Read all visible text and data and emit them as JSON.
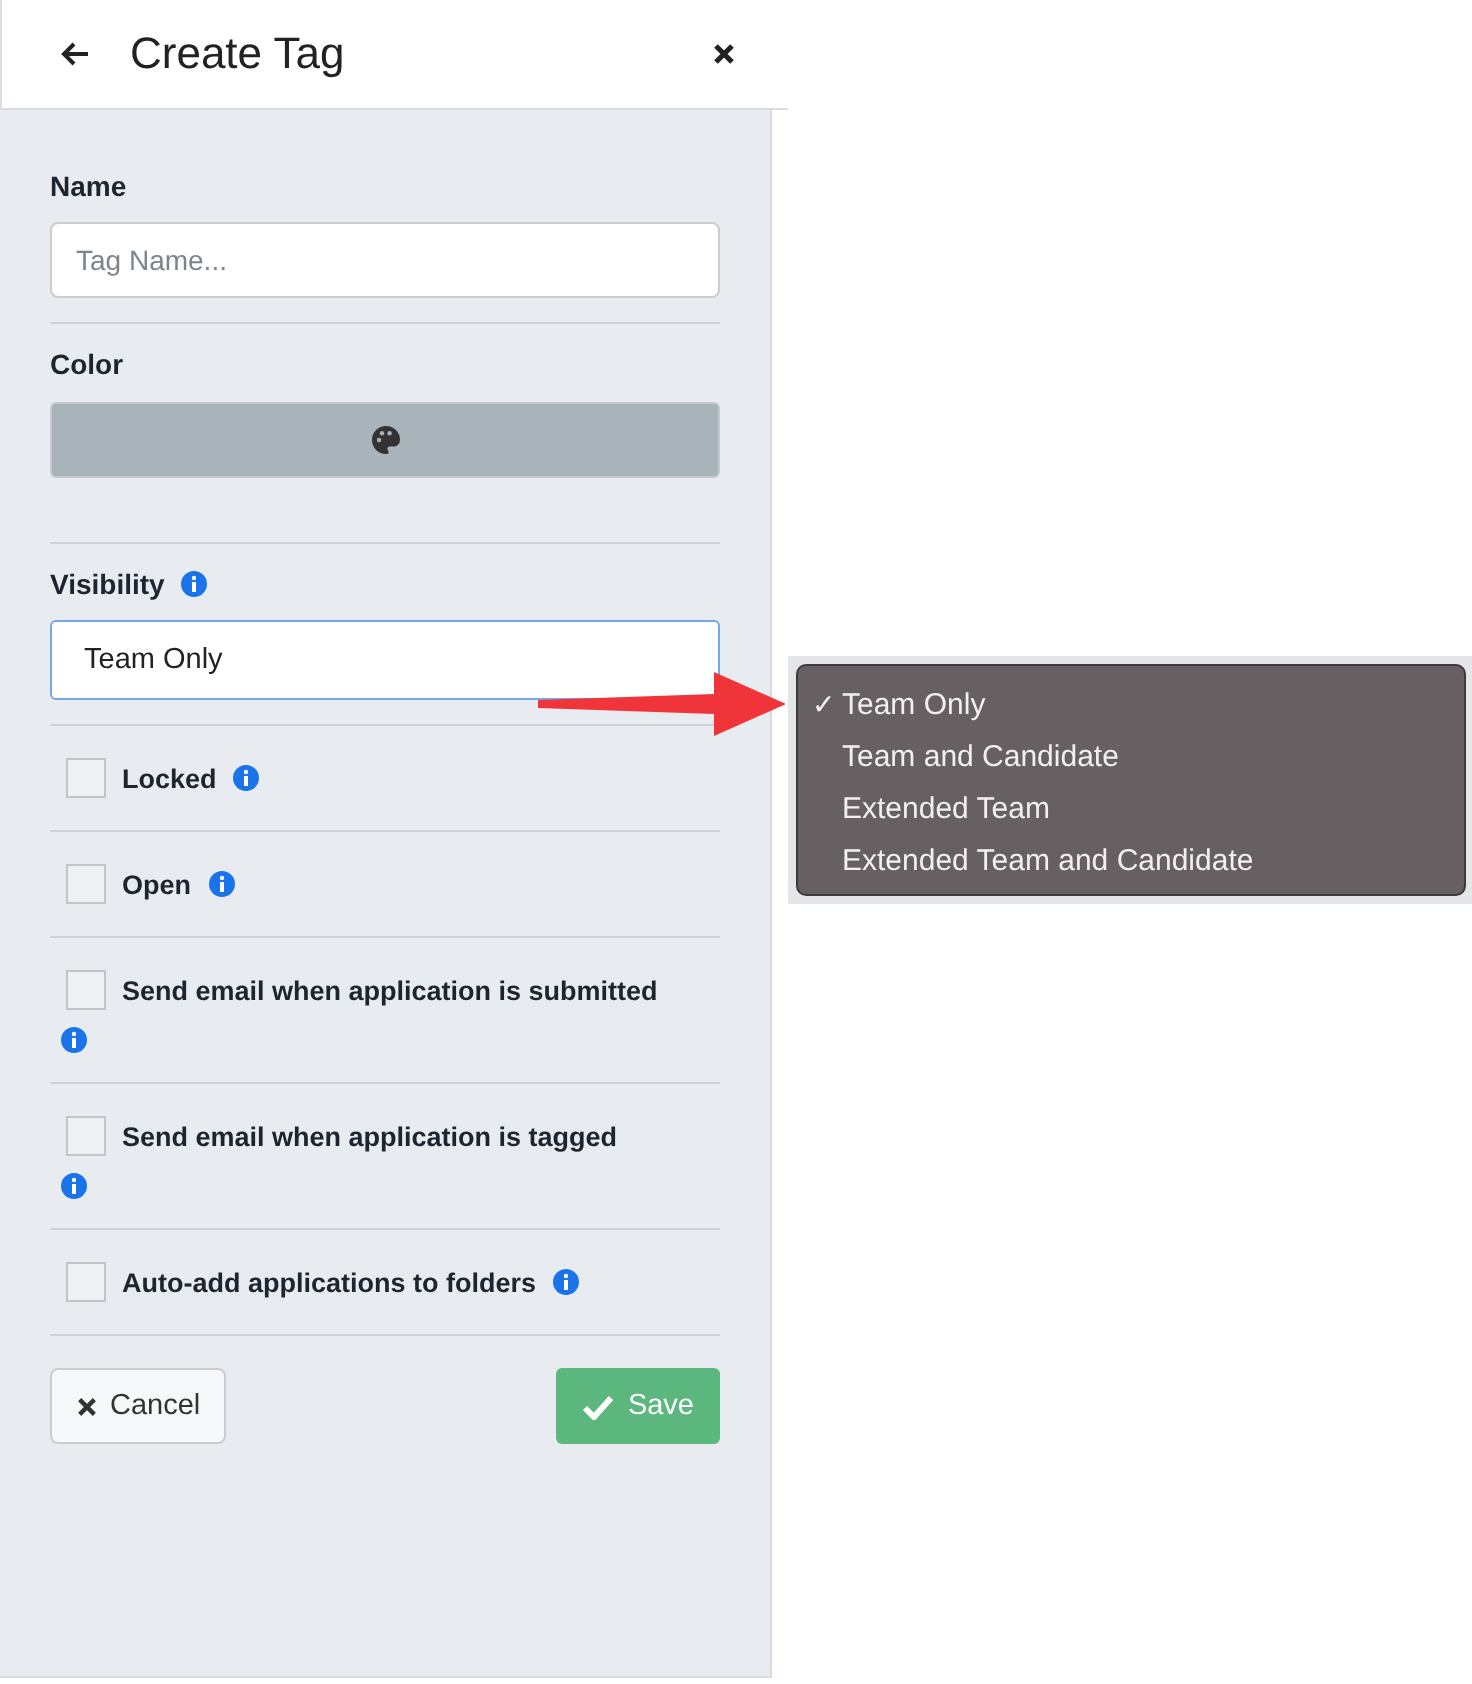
{
  "header": {
    "title": "Create Tag"
  },
  "name_field": {
    "label": "Name",
    "placeholder": "Tag Name..."
  },
  "color_field": {
    "label": "Color"
  },
  "visibility_field": {
    "label": "Visibility",
    "value": "Team Only"
  },
  "options": [
    {
      "label": "Locked",
      "checked": false,
      "kind": "inline-info"
    },
    {
      "label": "Open",
      "checked": false,
      "kind": "inline-info"
    },
    {
      "label": "Send email when application is submitted",
      "checked": false,
      "kind": "wrapped-info"
    },
    {
      "label": "Send email when application is tagged",
      "checked": false,
      "kind": "wrapped-info"
    },
    {
      "label": "Auto-add applications to folders",
      "checked": false,
      "kind": "inline-info"
    }
  ],
  "buttons": {
    "cancel": "Cancel",
    "save": "Save"
  },
  "dropdown_menu": [
    {
      "label": "Team Only",
      "selected": true
    },
    {
      "label": "Team and Candidate",
      "selected": false
    },
    {
      "label": "Extended Team",
      "selected": false
    },
    {
      "label": "Extended Team and Candidate",
      "selected": false
    }
  ],
  "selected_mark": "✓"
}
